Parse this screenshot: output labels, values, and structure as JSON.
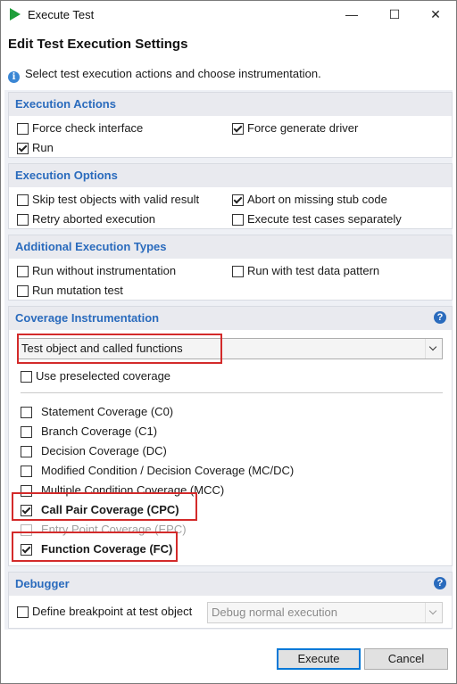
{
  "window": {
    "title": "Execute Test",
    "controls": {
      "minimize": "—",
      "maximize": "☐",
      "close": "✕"
    }
  },
  "dialog": {
    "title": "Edit Test Execution Settings",
    "info_text": "Select test execution actions and choose instrumentation.",
    "info_icon": "i"
  },
  "sections": {
    "execution_actions": {
      "title": "Execution Actions",
      "items": [
        {
          "label": "Force check interface",
          "checked": false
        },
        {
          "label": "Force generate driver",
          "checked": true
        },
        {
          "label": "Run",
          "checked": true
        }
      ]
    },
    "execution_options": {
      "title": "Execution Options",
      "items": [
        {
          "label": "Skip test objects with valid result",
          "checked": false
        },
        {
          "label": "Abort on missing stub code",
          "checked": true
        },
        {
          "label": "Retry aborted execution",
          "checked": false
        },
        {
          "label": "Execute test cases separately",
          "checked": false
        }
      ]
    },
    "additional_types": {
      "title": "Additional Execution Types",
      "items": [
        {
          "label": "Run without instrumentation",
          "checked": false
        },
        {
          "label": "Run with test data pattern",
          "checked": false
        },
        {
          "label": "Run mutation test",
          "checked": false
        }
      ]
    },
    "coverage": {
      "title": "Coverage Instrumentation",
      "help": "?",
      "select_value": "Test object and called functions",
      "use_preselected": {
        "label": "Use preselected coverage",
        "checked": false
      },
      "items": [
        {
          "label": "Statement Coverage (C0)",
          "checked": false
        },
        {
          "label": "Branch Coverage (C1)",
          "checked": false
        },
        {
          "label": "Decision Coverage (DC)",
          "checked": false
        },
        {
          "label": "Modified Condition / Decision Coverage (MC/DC)",
          "checked": false
        },
        {
          "label": "Multiple Condition Coverage (MCC)",
          "checked": false
        },
        {
          "label": "Call Pair Coverage (CPC)",
          "checked": true
        },
        {
          "label": "Entry Point Coverage (EPC)",
          "checked": false,
          "disabled": true
        },
        {
          "label": "Function Coverage (FC)",
          "checked": true
        }
      ]
    },
    "debugger": {
      "title": "Debugger",
      "help": "?",
      "breakpoint": {
        "label": "Define breakpoint at test object",
        "checked": false
      },
      "mode_value": "Debug normal execution"
    }
  },
  "buttons": {
    "execute": "Execute",
    "cancel": "Cancel"
  },
  "colors": {
    "section_title": "#2a6bbd",
    "highlight": "#d32a2a",
    "primary_border": "#0078d7"
  }
}
